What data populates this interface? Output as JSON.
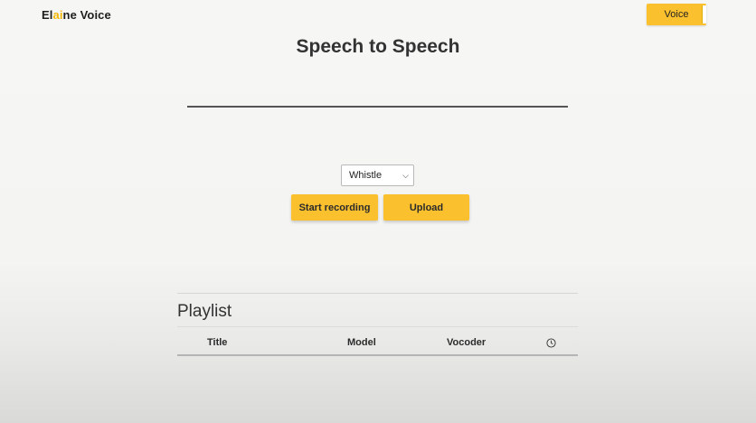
{
  "brand": {
    "prefix": "El",
    "highlight": "ai",
    "suffix": "ne Voice"
  },
  "header": {
    "voice_button_label": "Voice"
  },
  "main": {
    "title": "Speech to Speech",
    "model_select": {
      "selected": "Whistle"
    },
    "buttons": {
      "start_recording": "Start recording",
      "upload": "Upload"
    }
  },
  "playlist": {
    "heading": "Playlist",
    "columns": {
      "title": "Title",
      "model": "Model",
      "vocoder": "Vocoder",
      "duration_icon": "clock-icon"
    }
  },
  "colors": {
    "accent": "#fbc02d",
    "brand_highlight": "#f2b705"
  }
}
